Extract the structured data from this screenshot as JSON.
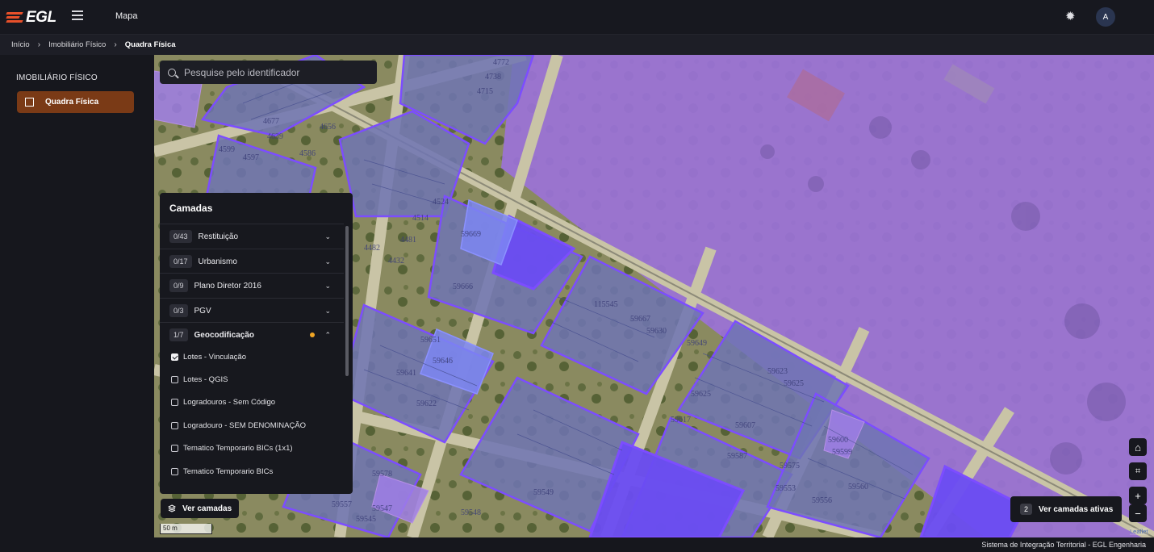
{
  "header": {
    "title": "Mapa",
    "avatar_initial": "A",
    "logo_text": "EGL"
  },
  "breadcrumb": {
    "items": [
      "Início",
      "Imobiliário Físico",
      "Quadra Física"
    ]
  },
  "sidebar": {
    "heading": "IMOBILIÁRIO FÍSICO",
    "items": [
      {
        "label": "Quadra Física",
        "icon": "crop-square-icon",
        "active": true
      }
    ]
  },
  "search": {
    "placeholder": "Pesquise pelo identificador"
  },
  "layers_panel": {
    "title": "Camadas",
    "groups": [
      {
        "badge": "0/43",
        "label": "Restituição",
        "expanded": false
      },
      {
        "badge": "0/17",
        "label": "Urbanismo",
        "expanded": false
      },
      {
        "badge": "0/9",
        "label": "Plano Diretor 2016",
        "expanded": false
      },
      {
        "badge": "0/3",
        "label": "PGV",
        "expanded": false
      },
      {
        "badge": "1/7",
        "label": "Geocodificação",
        "expanded": true,
        "indicator_color": "#f0a524"
      }
    ],
    "layers": [
      {
        "label": "Lotes - Vinculação",
        "checked": true
      },
      {
        "label": "Lotes - QGIS",
        "checked": false
      },
      {
        "label": "Logradouros - Sem Código",
        "checked": false
      },
      {
        "label": "Logradouro - SEM DENOMINAÇÃO",
        "checked": false
      },
      {
        "label": "Tematico Temporario BICs (1x1)",
        "checked": false
      },
      {
        "label": "Tematico Temporario BICs",
        "checked": false
      }
    ]
  },
  "map": {
    "ver_camadas_label": "Ver camadas",
    "scale_label": "50 m",
    "active_layers_count": "2",
    "active_layers_label": "Ver camadas ativas",
    "attribution": "Leaflet",
    "parcel_color": "#6a58e6",
    "lot_labels": [
      "4772",
      "4738",
      "4715",
      "4677",
      "4656",
      "4639",
      "4599",
      "4597",
      "4586",
      "4524",
      "4514",
      "4481",
      "4482",
      "4432",
      "59669",
      "59666",
      "115545",
      "59667",
      "59630",
      "59651",
      "59649",
      "59646",
      "59641",
      "59622",
      "59617",
      "59625",
      "59623",
      "59625",
      "59607",
      "59600",
      "59599",
      "59587",
      "59575",
      "59560",
      "59556",
      "59553",
      "59545",
      "59547",
      "59548",
      "59549",
      "59578",
      "59557"
    ]
  },
  "footer": {
    "text": "Sistema de Integração Territorial - EGL Engenharia"
  }
}
